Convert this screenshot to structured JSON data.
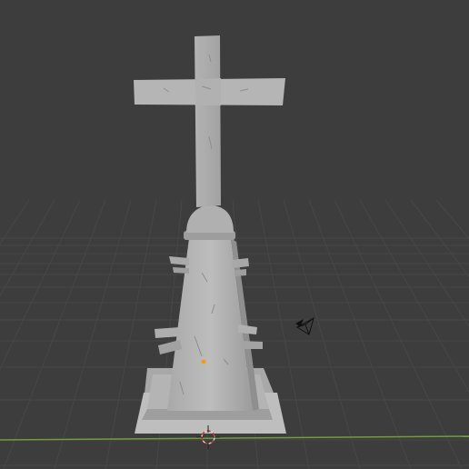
{
  "viewport": {
    "background": "#3d3d3d",
    "grid_color": "#474747",
    "x_axis_color": "#6f9e3a",
    "model_color": "#b9b9b9",
    "origin_color": "#f39a1c",
    "cursor_colors": [
      "#d0d0d0",
      "#c23a3a"
    ]
  },
  "objects": {
    "mesh": "gravestone-cross",
    "camera": "camera-icon",
    "origin": "object-origin-dot",
    "cursor": "3d-cursor"
  }
}
